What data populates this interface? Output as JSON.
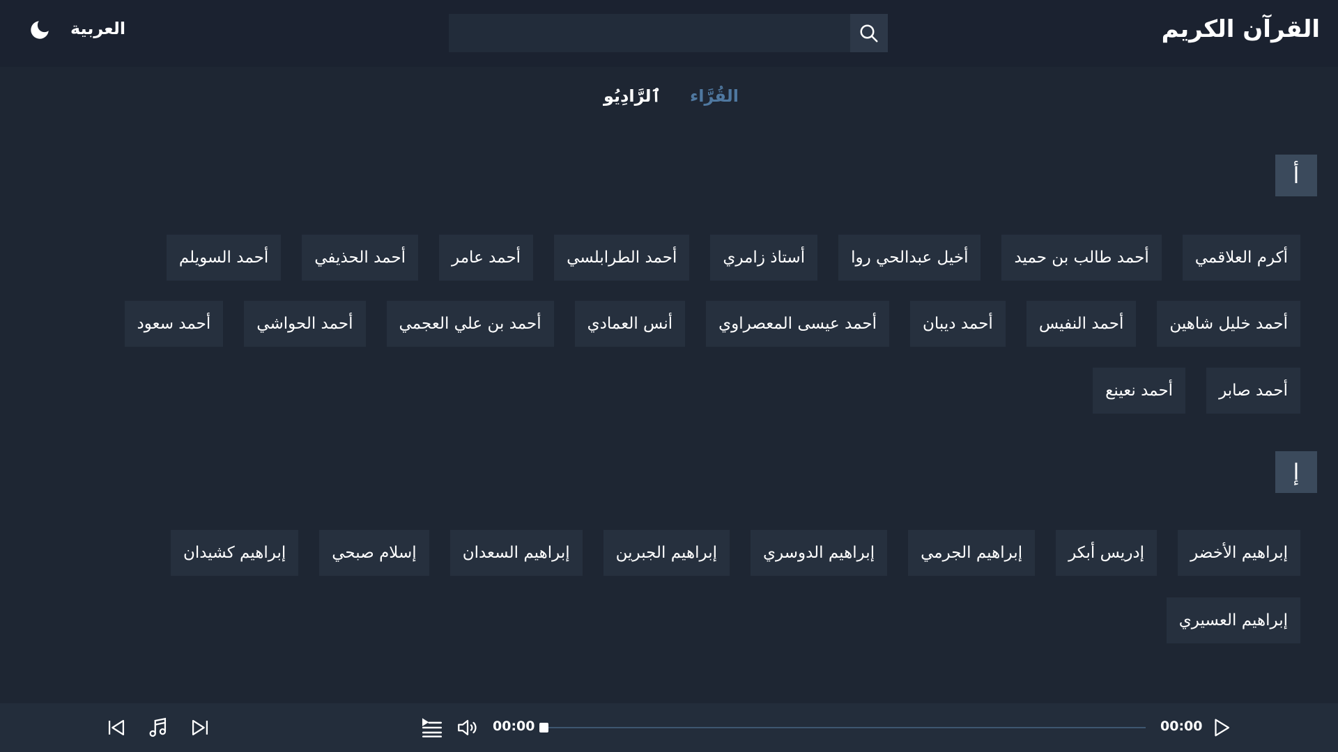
{
  "header": {
    "title": "القرآن الكريم",
    "search_placeholder": "",
    "language": "العربية",
    "theme_icon": "moon-icon",
    "search_icon": "search-icon"
  },
  "tabs": [
    {
      "label": "القُرَّاء",
      "active": true
    },
    {
      "label": "ٱلرَّادِيُو",
      "active": false
    }
  ],
  "sections": [
    {
      "letter": "أ",
      "rows": [
        [
          "أكرم العلاقمي",
          "أحمد طالب بن حميد",
          "أخيل عبدالحي روا",
          "أستاذ زامري",
          "أحمد الطرابلسي",
          "أحمد عامر",
          "أحمد الحذيفي",
          "أحمد السويلم"
        ],
        [
          "أحمد خليل شاهين",
          "أحمد النفيس",
          "أحمد ديبان",
          "أحمد عيسى المعصراوي",
          "أنس العمادي",
          "أحمد بن علي العجمي",
          "أحمد الحواشي",
          "أحمد سعود"
        ],
        [
          "أحمد صابر",
          "أحمد نعينع"
        ]
      ]
    },
    {
      "letter": "إ",
      "rows": [
        [
          "إبراهيم الأخضر",
          "إدريس أبكر",
          "إبراهيم الجرمي",
          "إبراهيم الدوسري",
          "إبراهيم الجبرين",
          "إبراهيم السعدان",
          "إسلام صبحي",
          "إبراهيم كشيدان"
        ],
        [
          "إبراهيم العسيري"
        ]
      ]
    }
  ],
  "player": {
    "current_time": "00:00",
    "duration": "00:00",
    "progress": 0,
    "icons": [
      "previous-icon",
      "music-icon",
      "next-icon",
      "playlist-icon",
      "volume-icon",
      "play-icon"
    ]
  },
  "colors": {
    "background": "#1e2633",
    "header": "#1b2230",
    "button": "#26303e",
    "badge": "#3b4a5c",
    "active_tab": "#4f78a0",
    "player": "#232d3b"
  }
}
